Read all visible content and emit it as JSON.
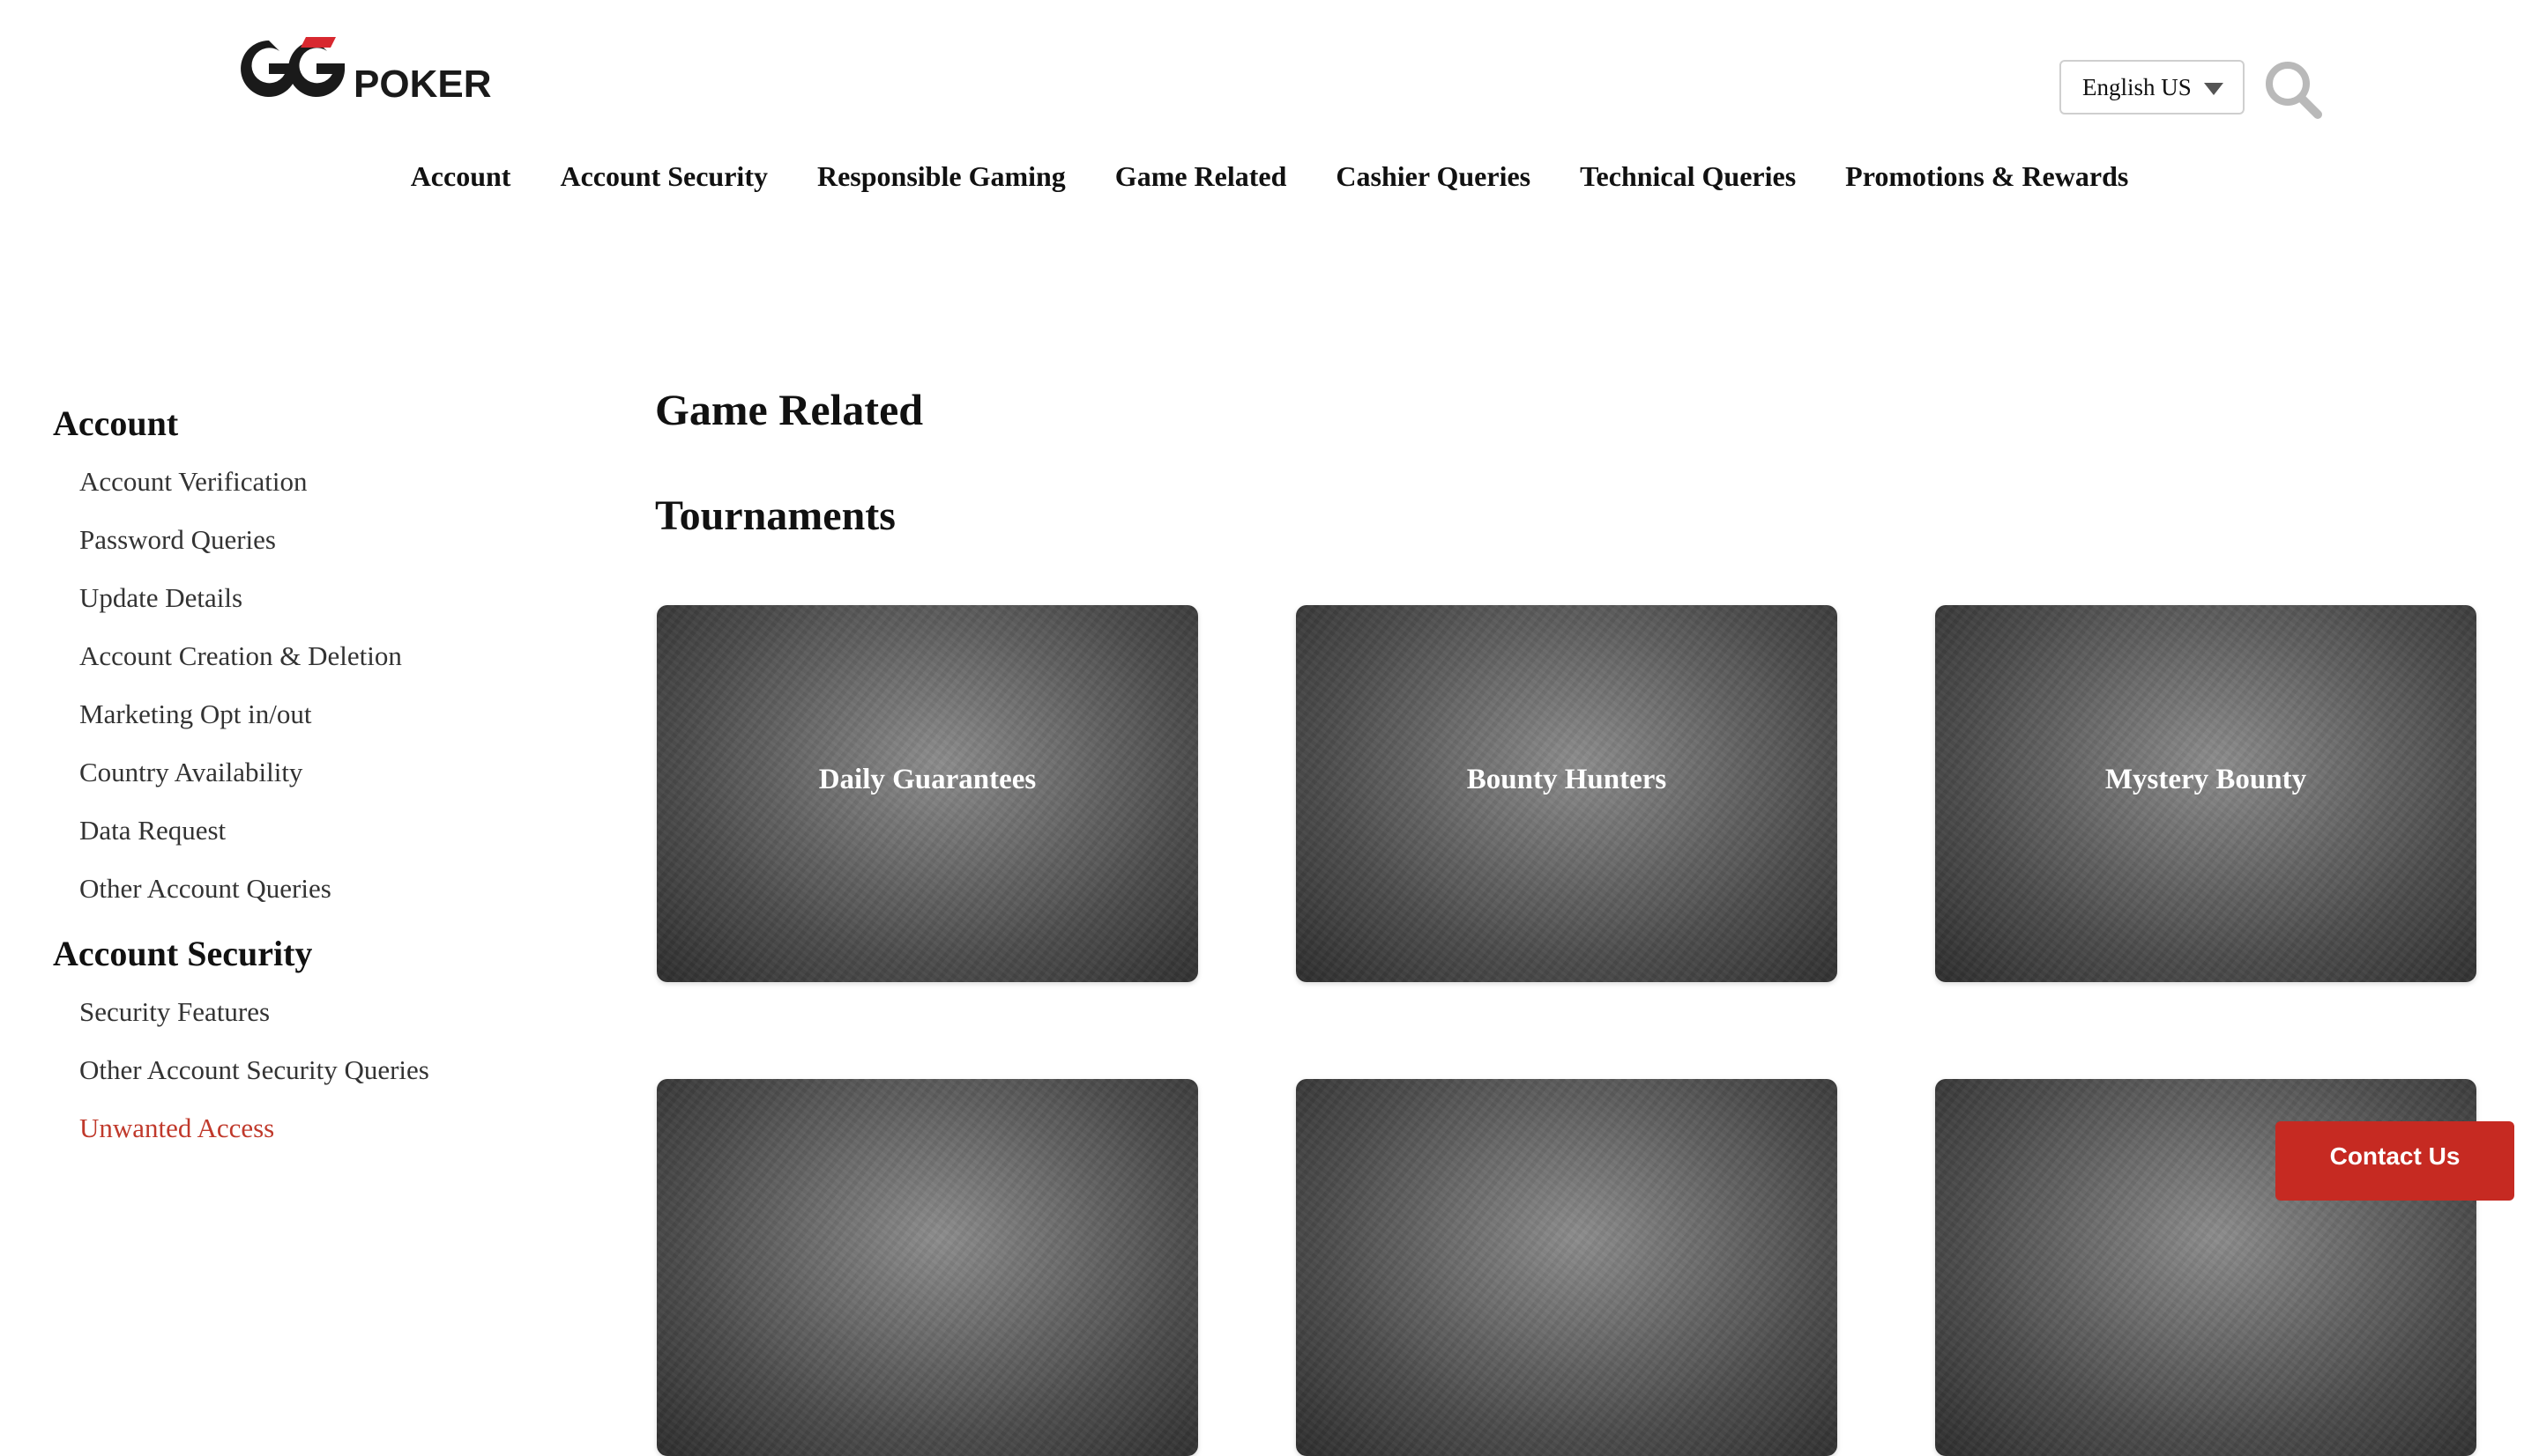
{
  "brand": {
    "logo_text": "GGPOKER"
  },
  "header": {
    "language": {
      "selected": "English US"
    },
    "search_icon": "magnifier-icon"
  },
  "topnav": {
    "items": [
      {
        "label": "Account"
      },
      {
        "label": "Account Security"
      },
      {
        "label": "Responsible Gaming"
      },
      {
        "label": "Game Related"
      },
      {
        "label": "Cashier Queries"
      },
      {
        "label": "Technical Queries"
      },
      {
        "label": "Promotions & Rewards"
      }
    ]
  },
  "sidebar": {
    "sections": [
      {
        "heading": "Account",
        "items": [
          {
            "label": "Account Verification"
          },
          {
            "label": "Password Queries"
          },
          {
            "label": "Update Details"
          },
          {
            "label": "Account Creation & Deletion"
          },
          {
            "label": "Marketing Opt in/out"
          },
          {
            "label": "Country Availability"
          },
          {
            "label": "Data Request"
          },
          {
            "label": "Other Account Queries"
          }
        ]
      },
      {
        "heading": "Account Security",
        "items": [
          {
            "label": "Security Features"
          },
          {
            "label": "Other Account Security Queries"
          },
          {
            "label": "Unwanted Access",
            "active": true
          }
        ]
      }
    ]
  },
  "main": {
    "title": "Game Related",
    "section_title": "Tournaments",
    "cards": [
      {
        "label": "Daily Guarantees"
      },
      {
        "label": "Bounty Hunters"
      },
      {
        "label": "Mystery Bounty"
      },
      {
        "label": ""
      },
      {
        "label": ""
      },
      {
        "label": ""
      }
    ]
  },
  "contact": {
    "label": "Contact Us"
  },
  "colors": {
    "accent": "#c62a22",
    "active_link": "#c0392b",
    "logo_red": "#d8282f",
    "logo_dark": "#1a1a1a"
  }
}
